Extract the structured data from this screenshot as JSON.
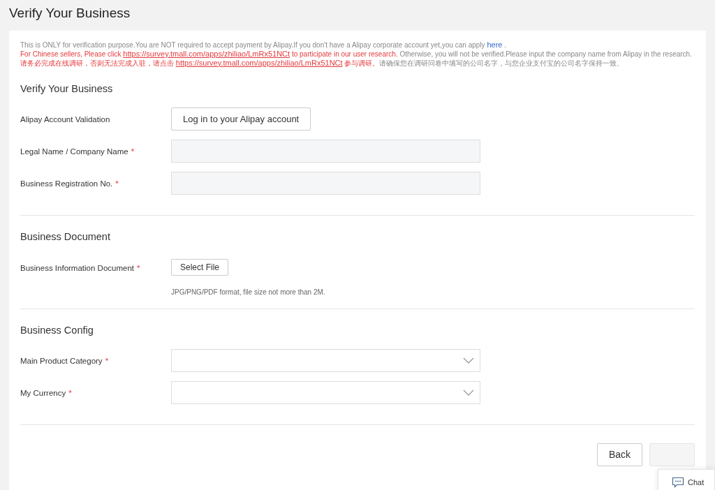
{
  "page_title": "Verify Your Business",
  "notice_lines": [
    [
      {
        "kind": "text",
        "color": "#888888",
        "text": "This is ONLY for verification purpose.You are NOT required to accept payment by Alipay.If you don't have a Alipay corporate account yet,you can apply "
      },
      {
        "kind": "link",
        "color": "#3366cc",
        "underline": false,
        "text": "here"
      },
      {
        "kind": "text",
        "color": "#888888",
        "text": " ."
      }
    ],
    [
      {
        "kind": "text",
        "color": "#e4393c",
        "text": "For Chinese sellers, Please click "
      },
      {
        "kind": "link",
        "color": "#e4393c",
        "text": "https://survey.tmall.com/apps/zhiliao/LmRx51NCt"
      },
      {
        "kind": "text",
        "color": "#e4393c",
        "text": " to participate in our user research."
      },
      {
        "kind": "text",
        "color": "#888888",
        "text": " Otherwise, you will not be verified.Please input the company name from Alipay in the research."
      }
    ],
    [
      {
        "kind": "text",
        "color": "#e4393c",
        "text": "请务必完成在线调研，否则无法完成入驻，请点击 "
      },
      {
        "kind": "link",
        "color": "#e4393c",
        "text": "https://survey.tmall.com/apps/zhiliao/LmRx51NCt"
      },
      {
        "kind": "text",
        "color": "#e4393c",
        "text": " 参与调研。"
      },
      {
        "kind": "text",
        "color": "#888888",
        "text": "请确保您在调研问卷中填写的公司名字，与您企业支付宝的公司名字保持一致。"
      }
    ]
  ],
  "sections": [
    {
      "title": "Verify Your Business",
      "fields": [
        {
          "kind": "button",
          "label": "Alipay Account Validation",
          "button": "Log in to your Alipay account"
        },
        {
          "kind": "text",
          "label": "Legal Name / Company Name",
          "required_mark": "*"
        },
        {
          "kind": "text",
          "label": "Business Registration No.",
          "required_mark": "*"
        }
      ]
    },
    {
      "title": "Business Document",
      "fields": [
        {
          "kind": "file",
          "label": "Business Information Document",
          "required_mark": "*",
          "button": "Select File",
          "hint": "JPG/PNG/PDF format, file size not more than 2M."
        }
      ]
    },
    {
      "title": "Business Config",
      "fields": [
        {
          "kind": "select",
          "label": "Main Product Category",
          "required_mark": "*"
        },
        {
          "kind": "select",
          "label": "My Currency",
          "required_mark": "*"
        }
      ]
    }
  ],
  "actions": [
    {
      "label": "Back",
      "disabled": false
    },
    {
      "disabled": true
    }
  ],
  "chat": {
    "label": "Chat"
  }
}
